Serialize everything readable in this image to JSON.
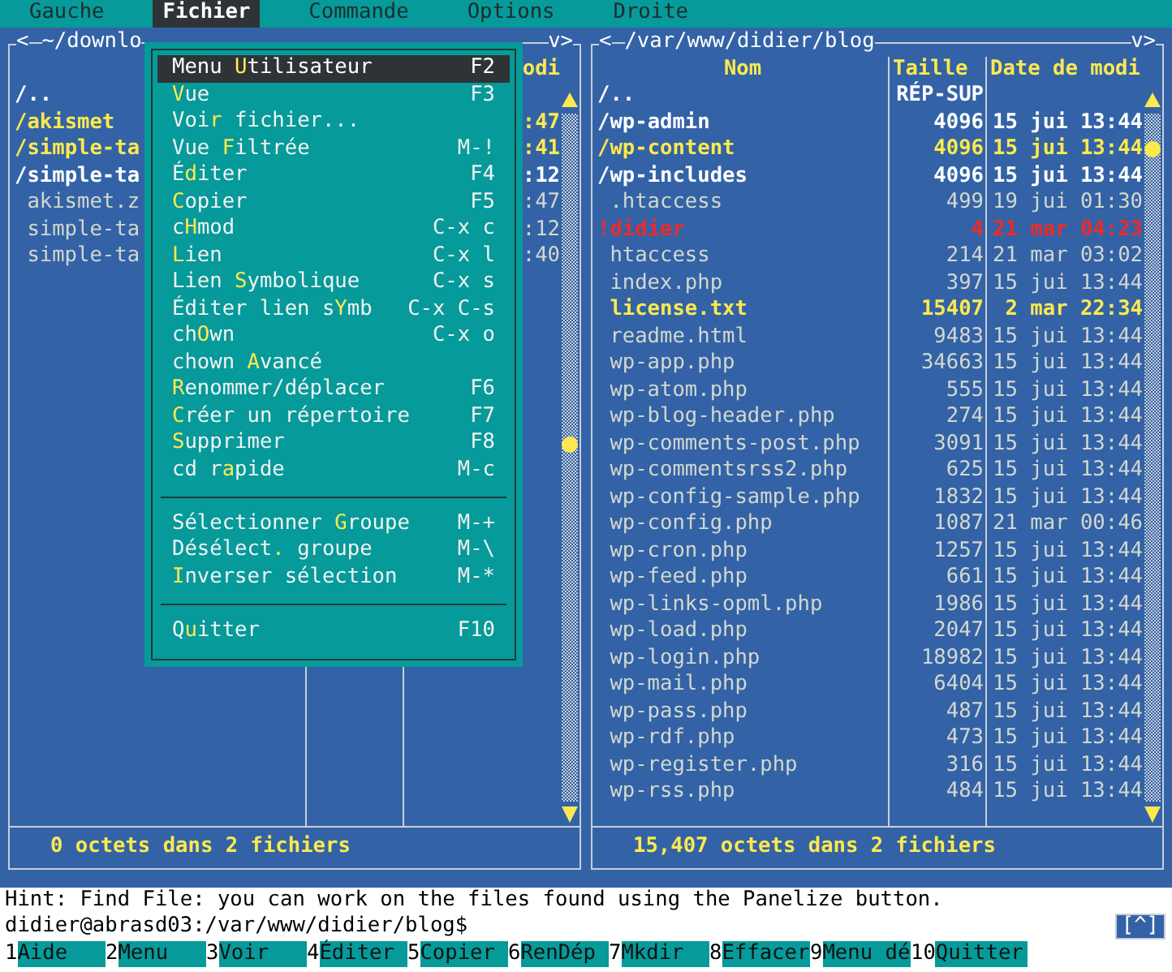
{
  "menu_bar": [
    {
      "label": "Gauche",
      "selected": false
    },
    {
      "label": "Fichier",
      "selected": true
    },
    {
      "label": "Commande",
      "selected": false
    },
    {
      "label": "Options",
      "selected": false
    },
    {
      "label": "Droite",
      "selected": false
    }
  ],
  "panels": [
    {
      "history_prev": "<",
      "path": "~/downlo",
      "history_next": "v>",
      "headers": {
        "date": "odi"
      },
      "rows": [
        {
          "name": "/..",
          "kind": "dir",
          "marked": false
        },
        {
          "name": "/akismet",
          "kind": "dir",
          "marked": true,
          "date": ":47"
        },
        {
          "name": "/simple-ta",
          "kind": "dir",
          "marked": true,
          "date": ":41"
        },
        {
          "name": "/simple-ta",
          "kind": "dir",
          "marked": false,
          "date": ":12"
        },
        {
          "name": "akismet.z",
          "kind": "file",
          "marked": false,
          "date": ":47"
        },
        {
          "name": "simple-ta",
          "kind": "file",
          "marked": false,
          "date": ":12"
        },
        {
          "name": "simple-ta",
          "kind": "file",
          "marked": false,
          "date": ":40"
        }
      ],
      "status": "0 octets dans 2 fichiers"
    },
    {
      "history_prev": "<",
      "path": "/var/www/didier/blog",
      "history_next": "v>",
      "headers": {
        "name": "Nom",
        "size": "Taille",
        "date": "Date de modi"
      },
      "rows": [
        {
          "name": "/..",
          "kind": "dir",
          "marked": false,
          "size": "RÉP-SUP"
        },
        {
          "name": "/wp-admin",
          "kind": "dir",
          "marked": false,
          "size": "4096",
          "date": "15 jui 13:44"
        },
        {
          "name": "/wp-content",
          "kind": "dir",
          "marked": true,
          "size": "4096",
          "date": "15 jui 13:44"
        },
        {
          "name": "/wp-includes",
          "kind": "dir",
          "marked": false,
          "size": "4096",
          "date": "15 jui 13:44"
        },
        {
          "name": ".htaccess",
          "kind": "file",
          "marked": false,
          "size": "499",
          "date": "19 jui 01:30"
        },
        {
          "name": "!didier",
          "kind": "broken",
          "marked": false,
          "size": "4",
          "date": "21 mar 04:23"
        },
        {
          "name": "htaccess",
          "kind": "file",
          "marked": false,
          "size": "214",
          "date": "21 mar 03:02"
        },
        {
          "name": "index.php",
          "kind": "file",
          "marked": false,
          "size": "397",
          "date": "15 jui 13:44"
        },
        {
          "name": "license.txt",
          "kind": "file",
          "marked": true,
          "size": "15407",
          "date": "2 mar 22:34"
        },
        {
          "name": "readme.html",
          "kind": "file",
          "marked": false,
          "size": "9483",
          "date": "15 jui 13:44"
        },
        {
          "name": "wp-app.php",
          "kind": "file",
          "marked": false,
          "size": "34663",
          "date": "15 jui 13:44"
        },
        {
          "name": "wp-atom.php",
          "kind": "file",
          "marked": false,
          "size": "555",
          "date": "15 jui 13:44"
        },
        {
          "name": "wp-blog-header.php",
          "kind": "file",
          "marked": false,
          "size": "274",
          "date": "15 jui 13:44"
        },
        {
          "name": "wp-comments-post.php",
          "kind": "file",
          "marked": false,
          "size": "3091",
          "date": "15 jui 13:44"
        },
        {
          "name": "wp-commentsrss2.php",
          "kind": "file",
          "marked": false,
          "size": "625",
          "date": "15 jui 13:44"
        },
        {
          "name": "wp-config-sample.php",
          "kind": "file",
          "marked": false,
          "size": "1832",
          "date": "15 jui 13:44"
        },
        {
          "name": "wp-config.php",
          "kind": "file",
          "marked": false,
          "size": "1087",
          "date": "21 mar 00:46"
        },
        {
          "name": "wp-cron.php",
          "kind": "file",
          "marked": false,
          "size": "1257",
          "date": "15 jui 13:44"
        },
        {
          "name": "wp-feed.php",
          "kind": "file",
          "marked": false,
          "size": "661",
          "date": "15 jui 13:44"
        },
        {
          "name": "wp-links-opml.php",
          "kind": "file",
          "marked": false,
          "size": "1986",
          "date": "15 jui 13:44"
        },
        {
          "name": "wp-load.php",
          "kind": "file",
          "marked": false,
          "size": "2047",
          "date": "15 jui 13:44"
        },
        {
          "name": "wp-login.php",
          "kind": "file",
          "marked": false,
          "size": "18982",
          "date": "15 jui 13:44"
        },
        {
          "name": "wp-mail.php",
          "kind": "file",
          "marked": false,
          "size": "6404",
          "date": "15 jui 13:44"
        },
        {
          "name": "wp-pass.php",
          "kind": "file",
          "marked": false,
          "size": "487",
          "date": "15 jui 13:44"
        },
        {
          "name": "wp-rdf.php",
          "kind": "file",
          "marked": false,
          "size": "473",
          "date": "15 jui 13:44"
        },
        {
          "name": "wp-register.php",
          "kind": "file",
          "marked": false,
          "size": "316",
          "date": "15 jui 13:44"
        },
        {
          "name": "wp-rss.php",
          "kind": "file",
          "marked": false,
          "size": "484",
          "date": "15 jui 13:44"
        }
      ],
      "status": "15,407 octets dans 2 fichiers"
    }
  ],
  "dropdown": [
    {
      "kind": "item",
      "before": "Menu ",
      "hotkey": "U",
      "after": "tilisateur",
      "shortcut": "F2",
      "selected": true
    },
    {
      "kind": "item",
      "hotkey": "V",
      "after": "ue",
      "shortcut": "F3",
      "selected": false
    },
    {
      "kind": "item",
      "before": "Voi",
      "hotkey": "r",
      "after": " fichier...",
      "selected": false
    },
    {
      "kind": "item",
      "before": "Vue ",
      "hotkey": "F",
      "after": "iltrée",
      "shortcut": "M-!",
      "selected": false
    },
    {
      "kind": "item",
      "before": "É",
      "hotkey": "d",
      "after": "iter",
      "shortcut": "F4",
      "selected": false
    },
    {
      "kind": "item",
      "hotkey": "C",
      "after": "opier",
      "shortcut": "F5",
      "selected": false
    },
    {
      "kind": "item",
      "before": "c",
      "hotkey": "H",
      "after": "mod",
      "shortcut": "C-x c",
      "selected": false
    },
    {
      "kind": "item",
      "hotkey": "L",
      "after": "ien",
      "shortcut": "C-x l",
      "selected": false
    },
    {
      "kind": "item",
      "before": "Lien ",
      "hotkey": "S",
      "after": "ymbolique",
      "shortcut": "C-x s",
      "selected": false
    },
    {
      "kind": "item",
      "before": "Éditer lien s",
      "hotkey": "Y",
      "after": "mb",
      "shortcut": "C-x C-s",
      "selected": false
    },
    {
      "kind": "item",
      "before": "ch",
      "hotkey": "O",
      "after": "wn",
      "shortcut": "C-x o",
      "selected": false
    },
    {
      "kind": "item",
      "before": "chown ",
      "hotkey": "A",
      "after": "vancé",
      "selected": false
    },
    {
      "kind": "item",
      "hotkey": "R",
      "after": "enommer/déplacer",
      "shortcut": "F6",
      "selected": false
    },
    {
      "kind": "item",
      "hotkey": "C",
      "after": "réer un répertoire",
      "shortcut": "F7",
      "selected": false
    },
    {
      "kind": "item",
      "hotkey": "S",
      "after": "upprimer",
      "shortcut": "F8",
      "selected": false
    },
    {
      "kind": "item",
      "before": "cd r",
      "hotkey": "a",
      "after": "pide",
      "shortcut": "M-c",
      "selected": false
    },
    {
      "kind": "separator"
    },
    {
      "kind": "item",
      "before": "Sélectionner ",
      "hotkey": "G",
      "after": "roupe",
      "shortcut": "M-+",
      "selected": false
    },
    {
      "kind": "item",
      "before": "Désélect",
      "hotkey": ".",
      "after": " groupe",
      "shortcut": "M-\\",
      "selected": false
    },
    {
      "kind": "item",
      "hotkey": "I",
      "after": "nverser sélection",
      "shortcut": "M-*",
      "selected": false
    },
    {
      "kind": "separator"
    },
    {
      "kind": "item",
      "before": "Q",
      "hotkey": "u",
      "after": "itter",
      "shortcut": "F10",
      "selected": false
    }
  ],
  "hint": "Hint: Find File: you can work on the files found using the Panelize button.",
  "prompt": "didier@abrasd03:/var/www/didier/blog$",
  "subshell_button": "[^]",
  "function_keys": [
    {
      "number": "1",
      "label": "Aide"
    },
    {
      "number": "2",
      "label": "Menu"
    },
    {
      "number": "3",
      "label": "Voir"
    },
    {
      "number": "4",
      "label": "Éditer"
    },
    {
      "number": "5",
      "label": "Copier"
    },
    {
      "number": "6",
      "label": "RenDép"
    },
    {
      "number": "7",
      "label": "Mkdir"
    },
    {
      "number": "8",
      "label": "Effacer"
    },
    {
      "number": "9",
      "label": "Menu dé"
    },
    {
      "number": "10",
      "label": "Quitter"
    }
  ]
}
